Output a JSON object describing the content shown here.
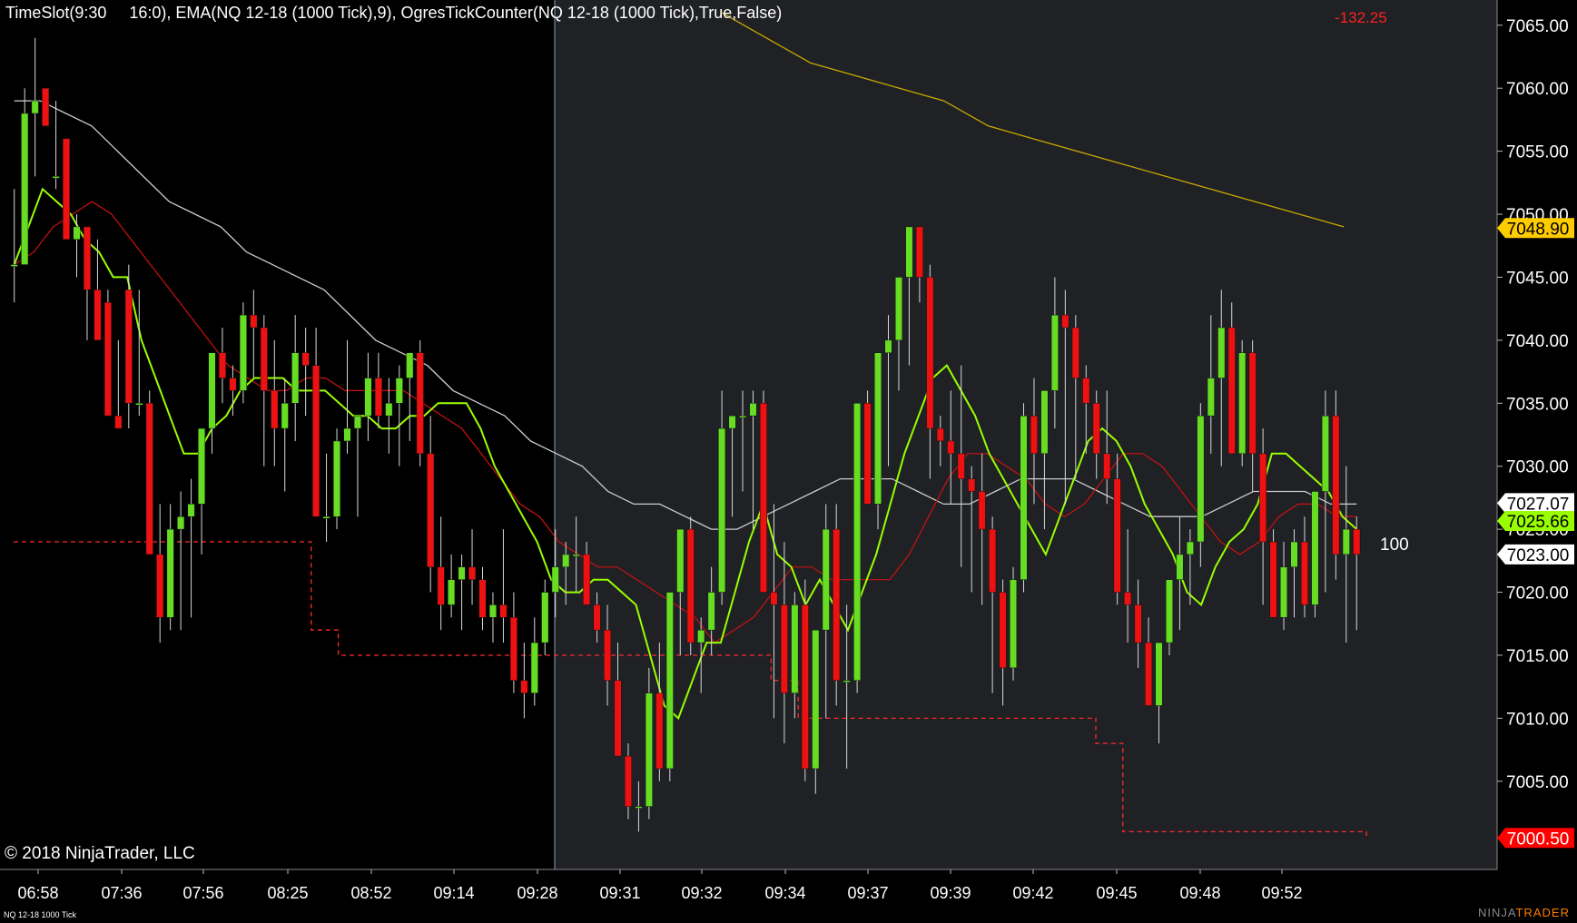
{
  "header": {
    "indicators": "TimeSlot(9:30     16:0), EMA(NQ 12-18 (1000 Tick),9), OgresTickCounter(NQ 12-18 (1000 Tick),True,False)",
    "pnl": "-132.25"
  },
  "footer": {
    "copyright": "© 2018 NinjaTrader, LLC",
    "instrument": "NQ 12-18 1000 Tick",
    "brand_ninja": "NINJA",
    "brand_trader": "TRADER"
  },
  "tick_counter": "100",
  "colors": {
    "background_left": "#000000",
    "background_right": "#1f2125",
    "up_candle": "#66dd22",
    "down_candle": "#ee1111",
    "ema_fast": "#99ff00",
    "ema_red": "#cc1111",
    "sma_white": "#cccccc",
    "sma_gold": "#c9a800"
  },
  "chart_data": {
    "type": "candlestick",
    "y_axis": {
      "range": [
        6998,
        7067
      ],
      "tick_labels": [
        "7065.00",
        "7060.00",
        "7055.00",
        "7050.00",
        "7045.00",
        "7040.00",
        "7035.00",
        "7030.00",
        "7025.00",
        "7020.00",
        "7015.00",
        "7010.00",
        "7005.00"
      ]
    },
    "x_axis": {
      "tick_labels": [
        "06:58",
        "07:36",
        "07:56",
        "08:25",
        "08:52",
        "09:14",
        "09:28",
        "09:31",
        "09:32",
        "09:34",
        "09:37",
        "09:39",
        "09:42",
        "09:45",
        "09:48",
        "09:52"
      ]
    },
    "price_markers": [
      {
        "value": "7048.90",
        "price": 7048.9,
        "bg": "#ffcc00",
        "fg": "#000000"
      },
      {
        "value": "7027.07",
        "price": 7027.07,
        "bg": "#ffffff",
        "fg": "#000000"
      },
      {
        "value": "7025.66",
        "price": 7025.66,
        "bg": "#99ff00",
        "fg": "#000000"
      },
      {
        "value": "7023.00",
        "price": 7023.0,
        "bg": "#ffffff",
        "fg": "#000000"
      },
      {
        "value": "7000.50",
        "price": 7000.5,
        "bg": "#ff0000",
        "fg": "#ffffff"
      }
    ],
    "candles": [
      [
        7046,
        7052,
        7043,
        7046
      ],
      [
        7046,
        7060,
        7046,
        7058
      ],
      [
        7058,
        7064,
        7053,
        7059
      ],
      [
        7060,
        7060,
        7058,
        7057
      ],
      [
        7053,
        7059,
        7052,
        7053
      ],
      [
        7056,
        7056,
        7048,
        7048
      ],
      [
        7048,
        7050,
        7045,
        7049
      ],
      [
        7049,
        7049,
        7040,
        7044
      ],
      [
        7044,
        7048,
        7043,
        7040
      ],
      [
        7043,
        7044,
        7036,
        7034
      ],
      [
        7034,
        7040,
        7033,
        7033
      ],
      [
        7044,
        7046,
        7033,
        7035
      ],
      [
        7035,
        7044,
        7034,
        7035
      ],
      [
        7035,
        7036,
        7023,
        7023
      ],
      [
        7023,
        7027,
        7016,
        7018
      ],
      [
        7018,
        7027,
        7017,
        7025
      ],
      [
        7025,
        7028,
        7017,
        7026
      ],
      [
        7026,
        7029,
        7018,
        7027
      ],
      [
        7027,
        7031,
        7023,
        7033
      ],
      [
        7033,
        7036,
        7031,
        7039
      ],
      [
        7039,
        7041,
        7035,
        7037
      ],
      [
        7037,
        7038,
        7034,
        7036
      ],
      [
        7036,
        7043,
        7035,
        7042
      ],
      [
        7042,
        7044,
        7037,
        7041
      ],
      [
        7041,
        7042,
        7030,
        7036
      ],
      [
        7036,
        7040,
        7030,
        7033
      ],
      [
        7033,
        7037,
        7028,
        7035
      ],
      [
        7035,
        7042,
        7032,
        7039
      ],
      [
        7039,
        7041,
        7034,
        7038
      ],
      [
        7038,
        7041,
        7028,
        7026
      ],
      [
        7026,
        7031,
        7024,
        7026
      ],
      [
        7026,
        7033,
        7025,
        7032
      ],
      [
        7032,
        7040,
        7031,
        7033
      ],
      [
        7033,
        7034,
        7026,
        7034
      ],
      [
        7034,
        7039,
        7032,
        7037
      ],
      [
        7037,
        7039,
        7033,
        7034
      ],
      [
        7034,
        7037,
        7031,
        7035
      ],
      [
        7035,
        7038,
        7030,
        7037
      ],
      [
        7037,
        7038,
        7032,
        7039
      ],
      [
        7039,
        7040,
        7030,
        7031
      ],
      [
        7031,
        7034,
        7020,
        7022
      ],
      [
        7022,
        7026,
        7017,
        7019
      ],
      [
        7019,
        7023,
        7018,
        7021
      ],
      [
        7021,
        7023,
        7017,
        7022
      ],
      [
        7022,
        7025,
        7019,
        7021
      ],
      [
        7021,
        7022,
        7017,
        7018
      ],
      [
        7018,
        7020,
        7016,
        7019
      ],
      [
        7019,
        7025,
        7016,
        7018
      ],
      [
        7018,
        7020,
        7012,
        7013
      ],
      [
        7013,
        7016,
        7010,
        7012
      ],
      [
        7012,
        7018,
        7011,
        7016
      ],
      [
        7016,
        7021,
        7015,
        7020
      ],
      [
        7020,
        7025,
        7018,
        7022
      ],
      [
        7022,
        7024,
        7019,
        7023
      ],
      [
        7023,
        7026,
        7020,
        7023
      ],
      [
        7023,
        7024,
        7020,
        7019
      ],
      [
        7019,
        7020,
        7016,
        7017
      ],
      [
        7017,
        7019,
        7011,
        7013
      ],
      [
        7013,
        7016,
        7007,
        7007
      ],
      [
        7007,
        7008,
        7002,
        7003
      ],
      [
        7003,
        7005,
        7001,
        7003
      ],
      [
        7003,
        7014,
        7002,
        7012
      ],
      [
        7012,
        7016,
        7005,
        7006
      ],
      [
        7006,
        7020,
        7005,
        7020
      ],
      [
        7020,
        7025,
        7015,
        7025
      ],
      [
        7025,
        7026,
        7015,
        7016
      ],
      [
        7016,
        7018,
        7012,
        7017
      ],
      [
        7017,
        7022,
        7015,
        7020
      ],
      [
        7020,
        7036,
        7019,
        7033
      ],
      [
        7033,
        7034,
        7026,
        7034
      ],
      [
        7034,
        7036,
        7028,
        7034
      ],
      [
        7034,
        7036,
        7025,
        7035
      ],
      [
        7035,
        7036,
        7022,
        7020
      ],
      [
        7020,
        7027,
        7010,
        7019
      ],
      [
        7019,
        7024,
        7008,
        7012
      ],
      [
        7012,
        7020,
        7010,
        7019
      ],
      [
        7019,
        7021,
        7005,
        7006
      ],
      [
        7006,
        7017,
        7004,
        7017
      ],
      [
        7017,
        7027,
        7010,
        7025
      ],
      [
        7025,
        7027,
        7011,
        7013
      ],
      [
        7013,
        7019,
        7006,
        7013
      ],
      [
        7013,
        7035,
        7012,
        7035
      ],
      [
        7035,
        7036,
        7027,
        7027
      ],
      [
        7027,
        7039,
        7025,
        7039
      ],
      [
        7039,
        7042,
        7030,
        7040
      ],
      [
        7040,
        7045,
        7036,
        7045
      ],
      [
        7045,
        7048,
        7038,
        7049
      ],
      [
        7049,
        7049,
        7043,
        7045
      ],
      [
        7045,
        7046,
        7029,
        7033
      ],
      [
        7033,
        7034,
        7030,
        7032
      ],
      [
        7032,
        7036,
        7027,
        7031
      ],
      [
        7031,
        7038,
        7022,
        7029
      ],
      [
        7029,
        7030,
        7020,
        7028
      ],
      [
        7028,
        7031,
        7019,
        7025
      ],
      [
        7025,
        7026,
        7012,
        7020
      ],
      [
        7020,
        7021,
        7011,
        7014
      ],
      [
        7014,
        7022,
        7013,
        7021
      ],
      [
        7021,
        7035,
        7020,
        7034
      ],
      [
        7034,
        7037,
        7027,
        7031
      ],
      [
        7031,
        7036,
        7025,
        7036
      ],
      [
        7036,
        7045,
        7033,
        7042
      ],
      [
        7042,
        7044,
        7027,
        7041
      ],
      [
        7041,
        7042,
        7029,
        7037
      ],
      [
        7037,
        7038,
        7031,
        7035
      ],
      [
        7035,
        7036,
        7029,
        7031
      ],
      [
        7031,
        7036,
        7027,
        7029
      ],
      [
        7029,
        7031,
        7019,
        7020
      ],
      [
        7020,
        7025,
        7016,
        7019
      ],
      [
        7019,
        7021,
        7014,
        7016
      ],
      [
        7016,
        7018,
        7011,
        7011
      ],
      [
        7011,
        7016,
        7008,
        7016
      ],
      [
        7016,
        7020,
        7015,
        7021
      ],
      [
        7021,
        7026,
        7017,
        7023
      ],
      [
        7023,
        7025,
        7019,
        7024
      ],
      [
        7024,
        7035,
        7022,
        7034
      ],
      [
        7034,
        7042,
        7031,
        7037
      ],
      [
        7037,
        7044,
        7030,
        7041
      ],
      [
        7041,
        7043,
        7031,
        7031
      ],
      [
        7031,
        7040,
        7030,
        7039
      ],
      [
        7039,
        7040,
        7028,
        7031
      ],
      [
        7031,
        7033,
        7019,
        7024
      ],
      [
        7024,
        7025,
        7018,
        7018
      ],
      [
        7018,
        7024,
        7017,
        7022
      ],
      [
        7022,
        7025,
        7018,
        7024
      ],
      [
        7024,
        7026,
        7018,
        7019
      ],
      [
        7019,
        7027,
        7018,
        7028
      ],
      [
        7028,
        7036,
        7020,
        7034
      ],
      [
        7034,
        7036,
        7021,
        7023
      ],
      [
        7023,
        7030,
        7016,
        7025
      ],
      [
        7025,
        7026,
        7017,
        7023
      ]
    ],
    "ema_green": [
      7046,
      7049,
      7052,
      7051,
      7050,
      7048,
      7047,
      7045,
      7045,
      7040,
      7037,
      7034,
      7031,
      7031,
      7033,
      7034,
      7036,
      7037,
      7037,
      7037,
      7036,
      7036,
      7036,
      7035,
      7034,
      7034,
      7033,
      7033,
      7034,
      7034,
      7035,
      7035,
      7035,
      7033,
      7030,
      7028,
      7026,
      7024,
      7021,
      7020,
      7020,
      7021,
      7021,
      7020,
      7019,
      7015,
      7011,
      7010,
      7013,
      7016,
      7016,
      7020,
      7024,
      7027,
      7023,
      7022,
      7019,
      7021,
      7019,
      7017,
      7020,
      7023,
      7027,
      7031,
      7034,
      7037,
      7038,
      7036,
      7034,
      7031,
      7029,
      7027,
      7025,
      7023,
      7026,
      7029,
      7032,
      7033,
      7032,
      7030,
      7027,
      7025,
      7023,
      7020,
      7019,
      7022,
      7024,
      7025,
      7027,
      7031,
      7031,
      7030,
      7029,
      7028,
      7026,
      7025
    ],
    "ema_red": [
      7046,
      7047,
      7049,
      7050,
      7051,
      7050,
      7048,
      7046,
      7044,
      7042,
      7040,
      7038,
      7037,
      7036,
      7036,
      7037,
      7037,
      7036,
      7036,
      7036,
      7036,
      7035,
      7034,
      7033,
      7031,
      7029,
      7027,
      7026,
      7024,
      7023,
      7022,
      7022,
      7021,
      7020,
      7019,
      7018,
      7016,
      7017,
      7018,
      7020,
      7022,
      7022,
      7021,
      7021,
      7021,
      7021,
      7023,
      7026,
      7029,
      7031,
      7031,
      7030,
      7029,
      7027,
      7026,
      7027,
      7029,
      7031,
      7031,
      7030,
      7028,
      7026,
      7024,
      7023,
      7024,
      7026,
      7027,
      7027,
      7026,
      7026
    ],
    "sma_white": [
      7059,
      7059,
      7058,
      7057,
      7055,
      7053,
      7051,
      7050,
      7049,
      7047,
      7046,
      7045,
      7044,
      7042,
      7040,
      7039,
      7038,
      7036,
      7035,
      7034,
      7032,
      7031,
      7030,
      7028,
      7027,
      7027,
      7026,
      7025,
      7025,
      7026,
      7027,
      7028,
      7029,
      7029,
      7029,
      7028,
      7027,
      7027,
      7028,
      7029,
      7029,
      7029,
      7028,
      7027,
      7026,
      7026,
      7026,
      7027,
      7028,
      7028,
      7028,
      7027,
      7027
    ],
    "sma_gold": [
      7066,
      7064,
      7062,
      7061,
      7060,
      7059,
      7057,
      7056,
      7055,
      7054,
      7053,
      7052,
      7051,
      7050,
      7049
    ],
    "step_line": [
      [
        0,
        7024
      ],
      [
        10,
        7024
      ],
      [
        11,
        7017
      ],
      [
        12,
        7015
      ],
      [
        27,
        7015
      ],
      [
        28,
        7013
      ],
      [
        29,
        7010
      ],
      [
        39,
        7010
      ],
      [
        40,
        7008
      ],
      [
        41,
        7001
      ],
      [
        50,
        7000.5
      ]
    ]
  }
}
